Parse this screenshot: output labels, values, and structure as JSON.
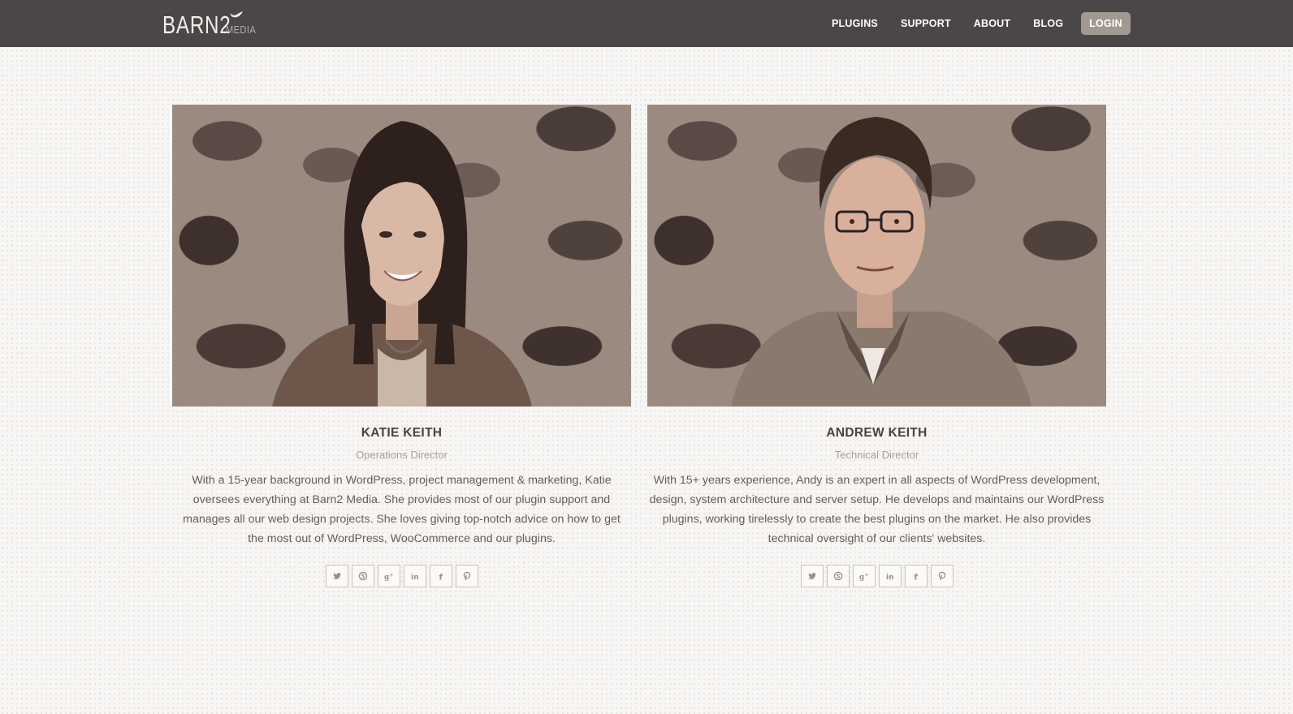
{
  "header": {
    "logo": {
      "main": "BARN2",
      "sub": "MEDIA"
    },
    "nav": [
      {
        "label": "PLUGINS"
      },
      {
        "label": "SUPPORT"
      },
      {
        "label": "ABOUT"
      },
      {
        "label": "BLOG"
      }
    ],
    "login_label": "LOGIN"
  },
  "team": [
    {
      "name": "KATIE KEITH",
      "role": "Operations Director",
      "bio": "With a 15-year background in WordPress, project management & marketing, Katie oversees everything at Barn2 Media. She provides most of our plugin support and manages all our web design projects. She loves giving top-notch advice on how to get the most out of WordPress, WooCommerce and our plugins.",
      "social": [
        "twitter-icon",
        "skype-icon",
        "google-plus-icon",
        "linkedin-icon",
        "facebook-icon",
        "pinterest-icon"
      ]
    },
    {
      "name": "ANDREW KEITH",
      "role": "Technical Director",
      "bio": "With 15+ years experience, Andy is an expert in all aspects of WordPress development, design, system architecture and server setup. He develops and maintains our WordPress plugins, working tirelessly to create the best plugins on the market. He also provides technical oversight of our clients' websites.",
      "social": [
        "twitter-icon",
        "skype-icon",
        "google-plus-icon",
        "linkedin-icon",
        "facebook-icon",
        "pinterest-icon"
      ]
    }
  ],
  "colors": {
    "header_bg": "#4b4749",
    "login_bg": "#a29992",
    "role_text": "#b49c8e"
  }
}
